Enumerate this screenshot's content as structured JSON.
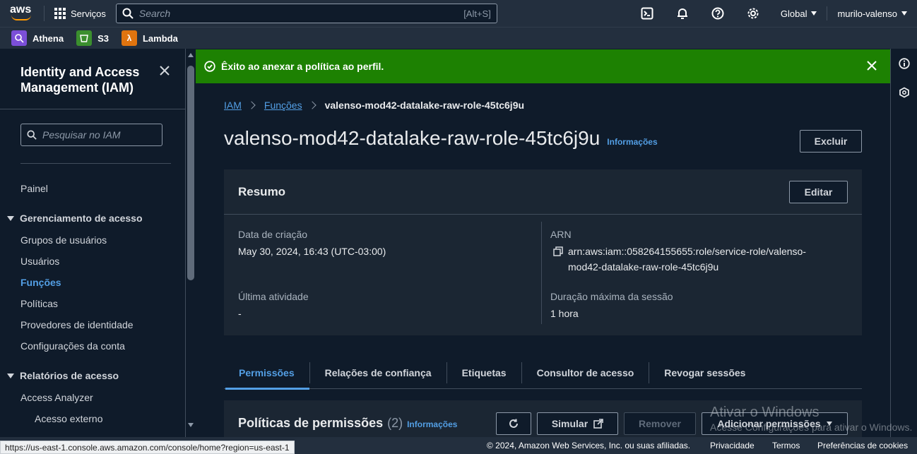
{
  "topnav": {
    "logo": "aws",
    "services_label": "Serviços",
    "search_placeholder": "Search",
    "search_shortcut": "[Alt+S]",
    "region_label": "Global",
    "user_label": "murilo-valenso"
  },
  "favorites": [
    {
      "label": "Athena",
      "color": "#7b4fd8"
    },
    {
      "label": "S3",
      "color": "#3b8f2e"
    },
    {
      "label": "Lambda",
      "color": "#e0740f"
    }
  ],
  "sidebar": {
    "title": "Identity and Access Management (IAM)",
    "search_placeholder": "Pesquisar no IAM",
    "dashboard": "Painel",
    "section_access": "Gerenciamento de acesso",
    "access_items": [
      "Grupos de usuários",
      "Usuários",
      "Funções",
      "Políticas",
      "Provedores de identidade",
      "Configurações da conta"
    ],
    "section_reports": "Relatórios de acesso",
    "report_items": [
      "Access Analyzer",
      "Acesso externo"
    ]
  },
  "flash": {
    "message": "Êxito ao anexar a política ao perfil."
  },
  "breadcrumb": {
    "root": "IAM",
    "parent": "Funções",
    "current": "valenso-mod42-datalake-raw-role-45tc6j9u"
  },
  "page": {
    "title": "valenso-mod42-datalake-raw-role-45tc6j9u",
    "info_label": "Informações",
    "delete_label": "Excluir"
  },
  "summary": {
    "title": "Resumo",
    "edit_label": "Editar",
    "created_label": "Data de criação",
    "created_value": "May 30, 2024, 16:43 (UTC-03:00)",
    "arn_label": "ARN",
    "arn_line1": "arn:aws:iam::058264155655:role/service-role/valenso-",
    "arn_line2": "mod42-datalake-raw-role-45tc6j9u",
    "last_activity_label": "Última atividade",
    "last_activity_value": "-",
    "max_session_label": "Duração máxima da sessão",
    "max_session_value": "1 hora"
  },
  "tabs": [
    "Permissões",
    "Relações de confiança",
    "Etiquetas",
    "Consultor de acesso",
    "Revogar sessões"
  ],
  "policies": {
    "title": "Políticas de permissões",
    "count": "(2)",
    "info_label": "Informações",
    "simulate_label": "Simular",
    "remove_label": "Remover",
    "add_label": "Adicionar permissões"
  },
  "watermark": {
    "line1": "Ativar o Windows",
    "line2": "Acesse Configurações para ativar o Windows."
  },
  "footer": {
    "copyright": "© 2024, Amazon Web Services, Inc. ou suas afiliadas.",
    "privacy": "Privacidade",
    "terms": "Termos",
    "cookies": "Preferências de cookies",
    "status_url": "https://us-east-1.console.aws.amazon.com/console/home?region=us-east-1"
  },
  "colors": {
    "accent": "#539fe5",
    "success": "#1d8102",
    "nav_bg": "#232f3e"
  }
}
